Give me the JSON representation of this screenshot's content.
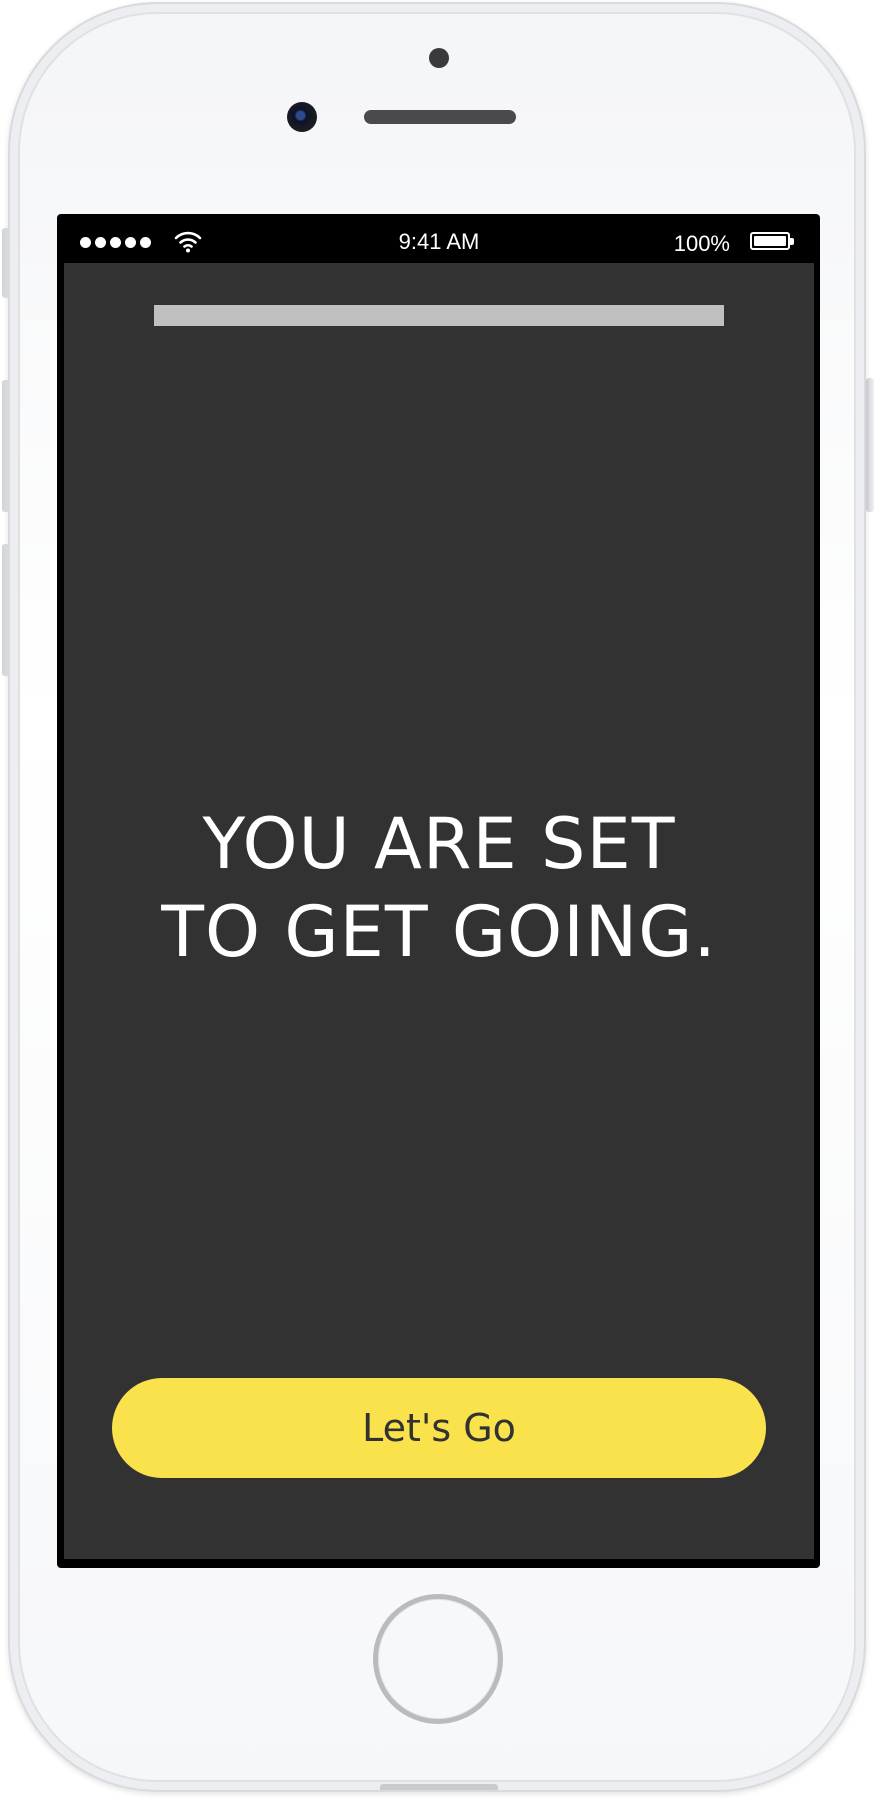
{
  "status_bar": {
    "time": "9:41 AM",
    "battery_percent": "100%",
    "signal_bars": 5,
    "wifi_icon": "wifi-icon",
    "battery_icon": "battery-icon",
    "battery_level": 1.0
  },
  "progress": {
    "value": 1.0
  },
  "main": {
    "headline_line1": "YOU ARE SET",
    "headline_line2": "TO GET GOING."
  },
  "cta": {
    "label": "Let's Go"
  },
  "colors": {
    "screen_background": "#323232",
    "accent": "#fae24c",
    "progress_bar": "#c0c0c0",
    "text": "#ffffff"
  }
}
